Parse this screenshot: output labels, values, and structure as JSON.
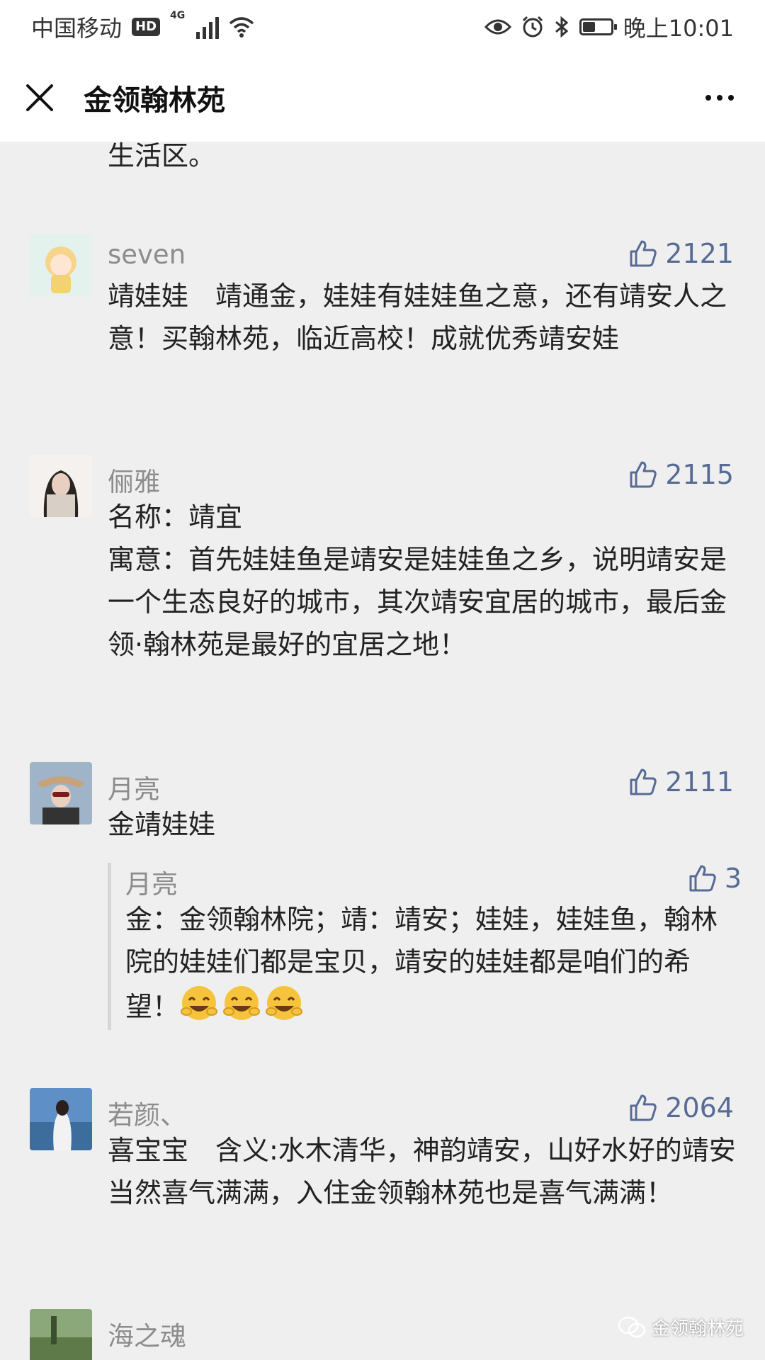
{
  "statusbar": {
    "carrier": "中国移动",
    "hd": "HD",
    "network": "4G",
    "time": "晚上10:01",
    "battery_level": 0.45
  },
  "header": {
    "title": "金领翰林苑"
  },
  "prev_text": "生活区。",
  "comments": [
    {
      "name": "seven",
      "likes": "2121",
      "text": "靖娃娃　靖通金，娃娃有娃娃鱼之意，还有靖安人之意！买翰林苑，临近高校！成就优秀靖安娃"
    },
    {
      "name": "俪雅",
      "likes": "2115",
      "text": "名称：靖宜\n寓意：首先娃娃鱼是靖安是娃娃鱼之乡，说明靖安是一个生态良好的城市，其次靖安宜居的城市，最后金领·翰林苑是最好的宜居之地！"
    },
    {
      "name": "月亮",
      "likes": "2111",
      "text": "金靖娃娃",
      "reply": {
        "name": "月亮",
        "likes": "3",
        "text": "金：金领翰林院；靖：靖安；娃娃，娃娃鱼，翰林院的娃娃们都是宝贝，靖安的娃娃都是咱们的希望！"
      }
    },
    {
      "name": "若颜、",
      "likes": "2064",
      "text": "喜宝宝　含义:水木清华，神韵靖安，山好水好的靖安当然喜气满满，入住金领翰林苑也是喜气满满！"
    },
    {
      "name": "海之魂",
      "likes": "",
      "text": ""
    }
  ],
  "watermark": "金领翰林苑"
}
